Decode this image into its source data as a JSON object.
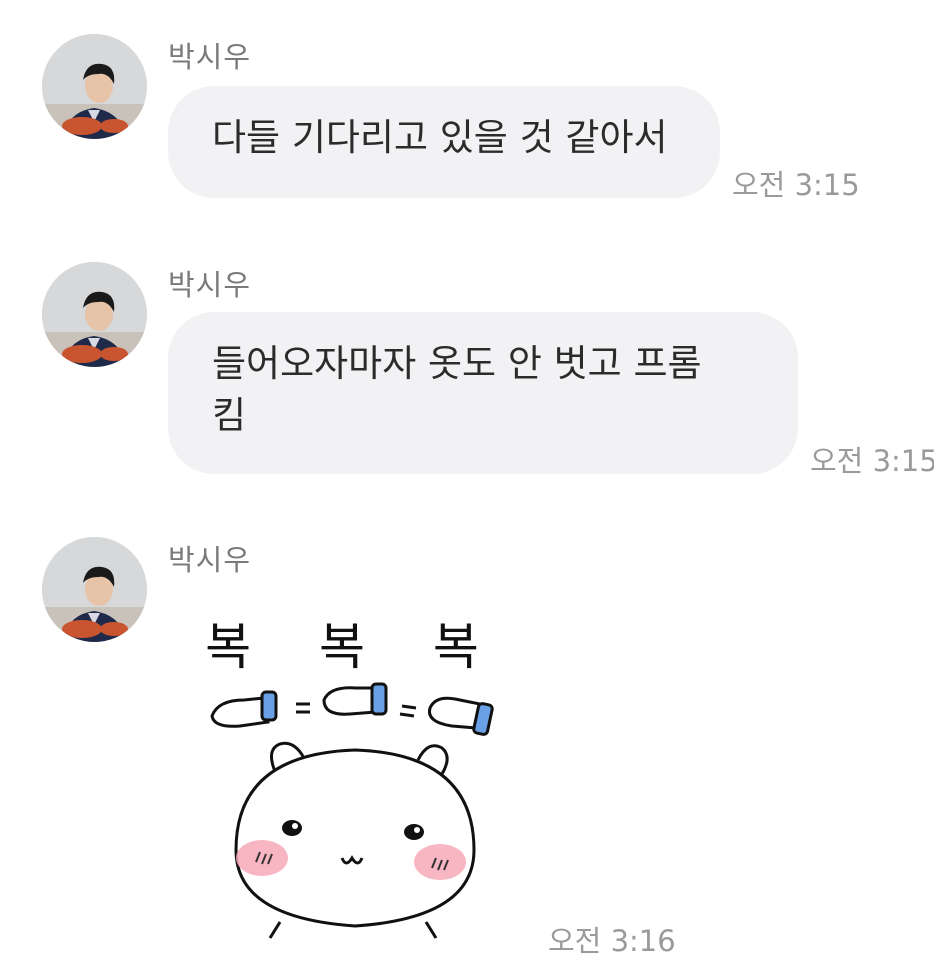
{
  "messages": [
    {
      "sender": "박시우",
      "text": "다들 기다리고 있을 것 같아서",
      "time": "오전 3:15"
    },
    {
      "sender": "박시우",
      "text_line1": "들어오자마자 옷도 안 벗고 프롬",
      "text_line2": "킴",
      "time": "오전 3:15"
    },
    {
      "sender": "박시우",
      "sticker_text": "복 복 복",
      "time": "오전 3:16"
    }
  ],
  "colors": {
    "bubble": "#f2f2f4",
    "sender": "#7a7a7a",
    "time": "#9a9a9a",
    "cheek": "#f7a9b8",
    "glove_cuff": "#6aa0e6"
  },
  "icons": {
    "avatar": "profile-photo",
    "sticker": "bear-boknok-sticker"
  }
}
